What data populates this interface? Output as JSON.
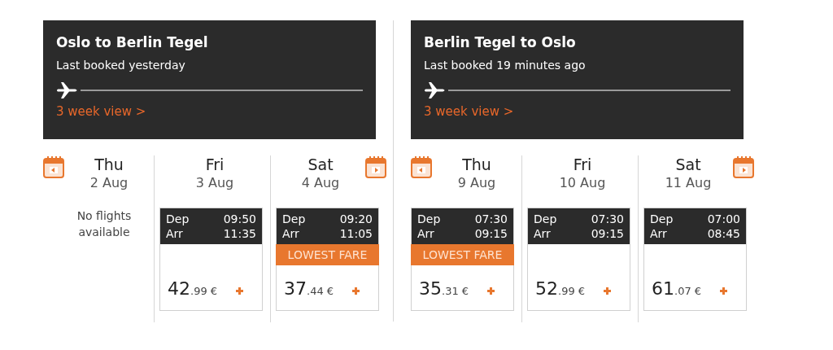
{
  "routes": [
    {
      "title": "Oslo to Berlin Tegel",
      "subtitle": "Last booked yesterday",
      "link": "3 week view >",
      "days": [
        {
          "kind": "none",
          "weekday": "Thu",
          "date": "2 Aug",
          "message": "No flights available"
        },
        {
          "kind": "flight",
          "weekday": "Fri",
          "date": "3 Aug",
          "dep_label": "Dep",
          "dep_time": "09:50",
          "arr_label": "Arr",
          "arr_time": "11:35",
          "lowest_fare": false,
          "price_whole": "42",
          "price_fraction": ".99 €"
        },
        {
          "kind": "flight",
          "weekday": "Sat",
          "date": "4 Aug",
          "dep_label": "Dep",
          "dep_time": "09:20",
          "arr_label": "Arr",
          "arr_time": "11:05",
          "lowest_fare": true,
          "lowest_fare_label": "LOWEST FARE",
          "price_whole": "37",
          "price_fraction": ".44 €"
        }
      ]
    },
    {
      "title": "Berlin Tegel to Oslo",
      "subtitle": "Last booked 19 minutes ago",
      "link": "3 week view >",
      "days": [
        {
          "kind": "flight",
          "weekday": "Thu",
          "date": "9 Aug",
          "dep_label": "Dep",
          "dep_time": "07:30",
          "arr_label": "Arr",
          "arr_time": "09:15",
          "lowest_fare": true,
          "lowest_fare_label": "LOWEST FARE",
          "price_whole": "35",
          "price_fraction": ".31 €"
        },
        {
          "kind": "flight",
          "weekday": "Fri",
          "date": "10 Aug",
          "dep_label": "Dep",
          "dep_time": "07:30",
          "arr_label": "Arr",
          "arr_time": "09:15",
          "lowest_fare": false,
          "price_whole": "52",
          "price_fraction": ".99 €"
        },
        {
          "kind": "flight",
          "weekday": "Sat",
          "date": "11 Aug",
          "dep_label": "Dep",
          "dep_time": "07:00",
          "arr_label": "Arr",
          "arr_time": "08:45",
          "lowest_fare": false,
          "price_whole": "61",
          "price_fraction": ".07 €"
        }
      ]
    }
  ]
}
